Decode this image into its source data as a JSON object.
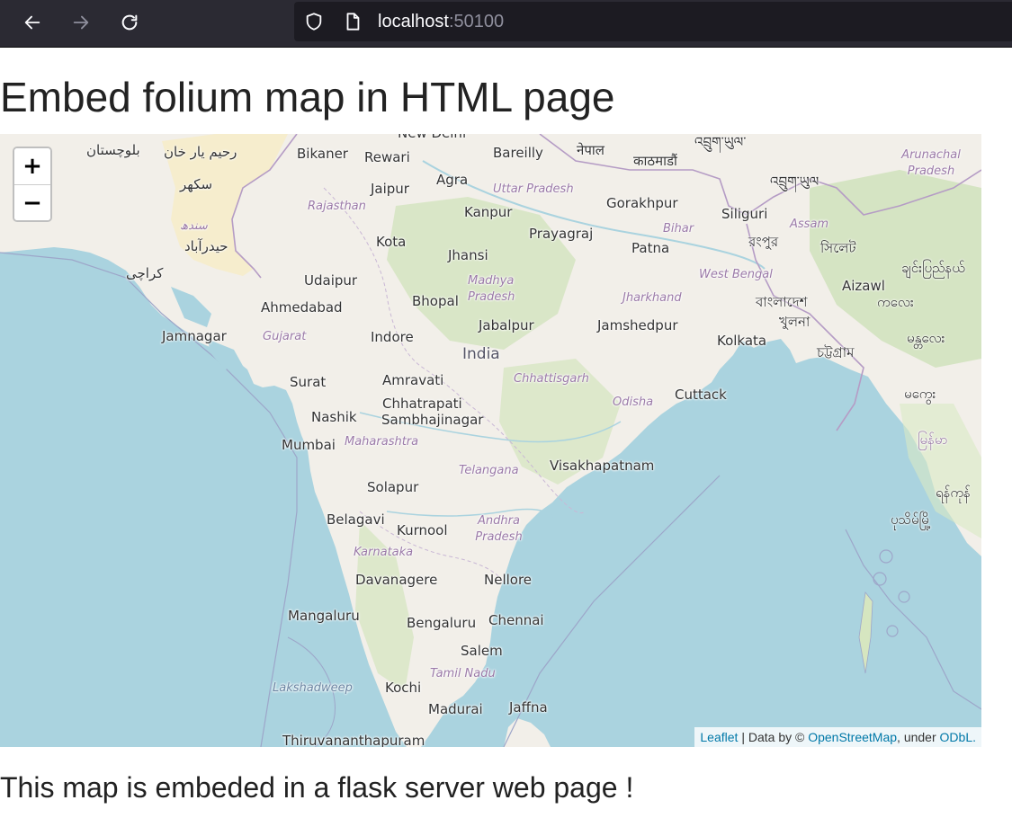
{
  "browser": {
    "url_host": "localhost",
    "url_port": ":50100"
  },
  "page": {
    "title": "Embed folium map in HTML page",
    "subtitle": "This map is embeded in a flask server web page !"
  },
  "map": {
    "zoom_in": "+",
    "zoom_out": "−",
    "attribution": {
      "leaflet": "Leaflet",
      "sep": " | Data by © ",
      "osm": "OpenStreetMap",
      "under": ", under ",
      "odbl": "ODbL."
    },
    "labels": {
      "balochistan": "بلوچستان",
      "rahim_yar_khan": "رحیم یار خان",
      "sukkur": "سکھر",
      "sindh": "سندھ",
      "hyderabad": "حیدرآباد",
      "karachi": "کراچی",
      "bikaner": "Bikaner",
      "rewari": "Rewari",
      "new_delhi": "New Delhi",
      "bareilly": "Bareilly",
      "nepal": "नेपाल",
      "kathmandu": "काठमाडौं",
      "bhutan_tib": "འབྲུག་ཡུལ་",
      "arunachal": "Arunachal Pradesh",
      "jaipur": "Jaipur",
      "agra": "Agra",
      "uttar_pradesh": "Uttar Pradesh",
      "rajasthan": "Rajasthan",
      "kanpur": "Kanpur",
      "gorakhpur": "Gorakhpur",
      "siliguri": "Siliguri",
      "bhutan": "འབྲུག་ཡུལ",
      "assam": "Assam",
      "prayagraj": "Prayagraj",
      "bihar": "Bihar",
      "kota": "Kota",
      "jhansi": "Jhansi",
      "patna": "Patna",
      "rangpur": "রংপুর",
      "sylhet": "সিলেট",
      "udaipur": "Udaipur",
      "madhya_pradesh": "Madhya Pradesh",
      "west_bengal": "West Bengal",
      "aizawl": "Aizawl",
      "chin": "ချင်းပြည်နယ်",
      "bhopal": "Bhopal",
      "jharkhand": "Jharkhand",
      "bangladesh": "বাংলাদেশ",
      "ahmedabad": "Ahmedabad",
      "khulna": "খুলনা",
      "jabalpur": "Jabalpur",
      "jamshedpur": "Jamshedpur",
      "jamnagar": "Jamnagar",
      "gujarat": "Gujarat",
      "indore": "Indore",
      "kolkata": "Kolkata",
      "chattogram": "চট্টগ্রাম",
      "india": "India",
      "surat": "Surat",
      "amravati": "Amravati",
      "chhattisgarh": "Chhattisgarh",
      "cuttack": "Cuttack",
      "chhatrapati": "Chhatrapati",
      "sambhajinagar": "Sambhajinagar",
      "odisha": "Odisha",
      "nashik": "Nashik",
      "mumbai": "Mumbai",
      "maharashtra": "Maharashtra",
      "telangana": "Telangana",
      "visakhapatnam": "Visakhapatnam",
      "solapur": "Solapur",
      "belagavi": "Belagavi",
      "kurnool": "Kurnool",
      "andhra": "Andhra Pradesh",
      "karnataka": "Karnataka",
      "davanagere": "Davanagere",
      "nellore": "Nellore",
      "mangaluru": "Mangaluru",
      "bengaluru": "Bengaluru",
      "chennai": "Chennai",
      "salem": "Salem",
      "tamil_nadu": "Tamil Nadu",
      "lakshadweep": "Lakshadweep",
      "kochi": "Kochi",
      "madurai": "Madurai",
      "jaffna": "Jaffna",
      "thiruvananthapuram": "Thiruvananthapuram",
      "myanmar": "မြန်မာ",
      "mandalay": "မန္တလေး",
      "magway": "မကွေး",
      "yangon": "ရန်ကုန်",
      "pathein": "ပုသိမ်မြို့",
      "tripura": "ကလေး"
    }
  }
}
